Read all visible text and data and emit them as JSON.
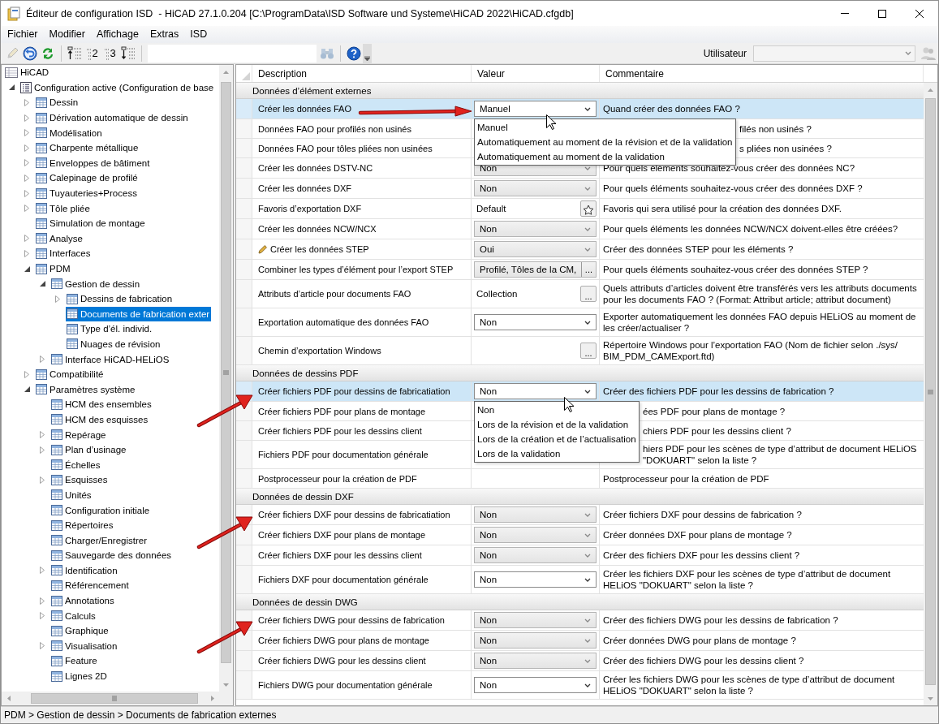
{
  "window": {
    "title": "Éditeur de configuration ISD  - HiCAD 27.1.0.204 [C:\\ProgramData\\ISD Software und Systeme\\HiCAD 2022\\HiCAD.cfgdb]"
  },
  "menu": [
    "Fichier",
    "Modifier",
    "Affichage",
    "Extras",
    "ISD"
  ],
  "toolbar": {
    "tools": [
      {
        "kind": "edit",
        "disabled": true
      },
      {
        "kind": "undo",
        "disabled": false
      },
      {
        "kind": "refresh",
        "disabled": false
      },
      {
        "kind": "separator"
      },
      {
        "kind": "collapse",
        "disabled": false
      },
      {
        "kind": "level",
        "label": "2",
        "disabled": false
      },
      {
        "kind": "level",
        "label": "3",
        "disabled": false
      },
      {
        "kind": "expand",
        "disabled": false
      },
      {
        "kind": "separator"
      },
      {
        "kind": "field"
      },
      {
        "kind": "find",
        "disabled": true
      },
      {
        "kind": "separator"
      },
      {
        "kind": "help",
        "disabled": false
      },
      {
        "kind": "overflow",
        "disabled": false
      }
    ],
    "user_label": "Utilisateur",
    "user_disabled": true
  },
  "tree": {
    "label": "HiCAD",
    "selected": false,
    "children": [
      {
        "label": "Configuration active (Configuration de base",
        "expanded": true,
        "selected": false,
        "children": [
          {
            "label": "Dessin",
            "expanded": false,
            "selected": false
          },
          {
            "label": "Dérivation automatique de dessin",
            "expanded": false,
            "selected": false
          },
          {
            "label": "Modélisation",
            "expanded": false,
            "selected": false
          },
          {
            "label": "Charpente métallique",
            "expanded": false,
            "selected": false
          },
          {
            "label": "Enveloppes de bâtiment",
            "expanded": false,
            "selected": false
          },
          {
            "label": "Calepinage de profilé",
            "expanded": false,
            "selected": false
          },
          {
            "label": "Tuyauteries+Process",
            "expanded": false,
            "selected": false
          },
          {
            "label": "Tôle pliée",
            "expanded": false,
            "selected": false
          },
          {
            "label": "Simulation de montage",
            "selected": false
          },
          {
            "label": "Analyse",
            "expanded": false,
            "selected": false
          },
          {
            "label": "Interfaces",
            "expanded": false,
            "selected": false
          },
          {
            "label": "PDM",
            "expanded": true,
            "selected": false,
            "children": [
              {
                "label": "Gestion de dessin",
                "expanded": true,
                "selected": false,
                "children": [
                  {
                    "label": "Dessins de fabrication",
                    "expanded": false,
                    "selected": false
                  },
                  {
                    "label": "Documents de fabrication exter",
                    "selected": true
                  },
                  {
                    "label": "Type d’él. individ.",
                    "selected": false
                  },
                  {
                    "label": "Nuages de révision",
                    "selected": false
                  }
                ]
              },
              {
                "label": "Interface HiCAD-HELiOS",
                "expanded": false,
                "selected": false
              }
            ]
          },
          {
            "label": "Compatibilité",
            "expanded": false,
            "selected": false
          },
          {
            "label": "Paramètres système",
            "expanded": true,
            "selected": false,
            "children": [
              {
                "label": "HCM des ensembles",
                "selected": false
              },
              {
                "label": "HCM des esquisses",
                "selected": false
              },
              {
                "label": "Repérage",
                "expanded": false,
                "selected": false
              },
              {
                "label": "Plan d’usinage",
                "expanded": false,
                "selected": false
              },
              {
                "label": "Échelles",
                "selected": false
              },
              {
                "label": "Esquisses",
                "expanded": false,
                "selected": false
              },
              {
                "label": "Unités",
                "selected": false
              },
              {
                "label": "Configuration initiale",
                "selected": false
              },
              {
                "label": "Répertoires",
                "selected": false
              },
              {
                "label": "Charger/Enregistrer",
                "selected": false
              },
              {
                "label": "Sauvegarde des données",
                "selected": false
              },
              {
                "label": "Identification",
                "expanded": false,
                "selected": false
              },
              {
                "label": "Référencement",
                "selected": false
              },
              {
                "label": "Annotations",
                "expanded": false,
                "selected": false
              },
              {
                "label": "Calculs",
                "expanded": false,
                "selected": false
              },
              {
                "label": "Graphique",
                "selected": false
              },
              {
                "label": "Visualisation",
                "expanded": false,
                "selected": false
              },
              {
                "label": "Feature",
                "selected": false
              },
              {
                "label": "Lignes 2D",
                "selected": false
              }
            ]
          }
        ]
      }
    ]
  },
  "grid": {
    "columns": [
      "Description",
      "Valeur",
      "Commentaire"
    ],
    "sections": [
      {
        "title": "Données d’élément externes",
        "rows": [
          {
            "description": "Créer les données FAO",
            "kind": "field",
            "value": "Manuel",
            "comment": "Quand créer des données FAO ?",
            "selected": true,
            "modified": false,
            "options": [
              "Manuel",
              "Automatiquement au moment de la révision et de la validation",
              "Automatiquement au moment de la validation"
            ]
          },
          {
            "description": "Données FAO pour profilés non usinés",
            "kind": "empty",
            "comment": "filés non usinés ?",
            "selected": false,
            "modified": false
          },
          {
            "description": "Données FAO pour tôles pliées non usinées",
            "kind": "empty",
            "comment": "s pliées non usinées ?",
            "selected": false,
            "modified": false
          },
          {
            "description": "Créer les données DSTV-NC",
            "kind": "combo",
            "value": "Non",
            "comment": "Pour quels éléments souhaitez-vous créer des données NC?",
            "selected": false,
            "modified": false
          },
          {
            "description": "Créer les données DXF",
            "kind": "combo",
            "value": "Non",
            "comment": "Pour quels éléments souhaitez-vous créer des données DXF ?",
            "selected": false,
            "modified": false
          },
          {
            "description": "Favoris d’exportation DXF",
            "kind": "star",
            "value": "Default",
            "comment": "Favoris qui sera utilisé pour la création des données DXF.",
            "selected": false,
            "modified": false
          },
          {
            "description": "Créer les données NCW/NCX",
            "kind": "combo",
            "value": "Non",
            "comment": "Pour quels éléments les données NCW/NCX doivent-elles être créées?",
            "selected": false,
            "modified": false
          },
          {
            "description": "Créer les données STEP",
            "kind": "combo",
            "value": "Oui",
            "comment": "Créer des données STEP pour les éléments ?",
            "selected": false,
            "modified": true
          },
          {
            "description": "Combiner les types d’élément pour l’export STEP",
            "kind": "box",
            "value": "Profilé, Tôles de la CM,",
            "button": "...",
            "comment": "Pour quels éléments souhaitez-vous créer des données STEP ?",
            "selected": false,
            "modified": false
          },
          {
            "description": "Attributs d’article pour documents FAO",
            "kind": "ellipsis",
            "value": "Collection",
            "button": "...",
            "comment": "Quels attributs d’articles doivent être transférés vers les attributs documents pour les documents FAO ?  (Format: Attribut article; attribut document)",
            "selected": false,
            "modified": false
          },
          {
            "description": "Exportation automatique des données FAO",
            "kind": "field",
            "value": "Non",
            "comment": "Exporter automatiquement les données FAO depuis HELiOS au moment de les créer/actualiser ?",
            "selected": false,
            "modified": false
          },
          {
            "description": "Chemin d’exportation Windows",
            "kind": "ellipsis",
            "button": "...",
            "comment": "Répertoire Windows pour l’exportation FAO (Nom de fichier selon ./sys/ BIM_PDM_CAMExport.ftd)",
            "selected": false,
            "modified": false
          }
        ]
      },
      {
        "title": "Données de dessins PDF",
        "rows": [
          {
            "description": "Créer fichiers PDF pour dessins de fabricatiation",
            "kind": "field",
            "value": "Non",
            "comment": "Créer des fichiers PDF pour les dessins de fabrication ?",
            "selected": true,
            "modified": false,
            "options": [
              "Non",
              "Lors de la révision et de la validation",
              "Lors de la création et de l’actualisation",
              "Lors de la validation"
            ]
          },
          {
            "description": "Créer fichiers PDF pour plans de montage",
            "kind": "empty",
            "comment": "ées PDF pour plans de montage ?",
            "selected": false,
            "modified": false
          },
          {
            "description": "Créer fichiers PDF pour les dessins client",
            "kind": "empty",
            "comment": "chiers PDF pour les dessins client ?",
            "selected": false,
            "modified": false
          },
          {
            "description": "Fichiers PDF pour documentation générale",
            "kind": "empty",
            "comment": "hiers PDF pour les scènes de type d’attribut de document HELiOS \"DOKUART\" selon la liste ?",
            "selected": false,
            "modified": false
          },
          {
            "description": "Postprocesseur pour la création de PDF",
            "kind": "empty",
            "comment": "Postprocesseur pour la création de PDF",
            "selected": false,
            "modified": false
          }
        ]
      },
      {
        "title": "Données de dessin DXF",
        "rows": [
          {
            "description": "Créer fichiers DXF pour dessins de fabricatiation",
            "kind": "combo",
            "value": "Non",
            "comment": "Créer fichiers DXF pour dessins de fabrication ?",
            "selected": false,
            "modified": false
          },
          {
            "description": "Créer fichiers DXF pour plans de montage",
            "kind": "combo",
            "value": "Non",
            "comment": "Créer données DXF pour plans de montage ?",
            "selected": false,
            "modified": false
          },
          {
            "description": "Créer fichiers DXF pour les dessins client",
            "kind": "combo",
            "value": "Non",
            "comment": "Créer des fichiers DXF pour les dessins client ?",
            "selected": false,
            "modified": false
          },
          {
            "description": "Fichiers DXF pour documentation générale",
            "kind": "field",
            "value": "Non",
            "comment": "Créer les fichiers DXF pour les scènes de type d’attribut de document HELiOS \"DOKUART\" selon la liste ?",
            "selected": false,
            "modified": false
          }
        ]
      },
      {
        "title": "Données de dessin DWG",
        "rows": [
          {
            "description": "Créer fichiers DWG pour dessins de fabrication",
            "kind": "combo",
            "value": "Non",
            "comment": "Créer des fichiers DWG pour les dessins de fabrication ?",
            "selected": false,
            "modified": false
          },
          {
            "description": "Créer fichiers DWG pour plans de montage",
            "kind": "combo",
            "value": "Non",
            "comment": "Créer données DWG pour plans de montage ?",
            "selected": false,
            "modified": false
          },
          {
            "description": "Créer fichiers DWG pour les dessins client",
            "kind": "combo",
            "value": "Non",
            "comment": "Créer des fichiers DWG pour les dessins client ?",
            "selected": false,
            "modified": false
          },
          {
            "description": "Fichiers DWG pour documentation générale",
            "kind": "field",
            "value": "Non",
            "comment": "Créer les fichiers DWG pour les scènes de type d’attribut de document HELiOS \"DOKUART\" selon la liste ?",
            "selected": false,
            "modified": false
          }
        ]
      }
    ]
  },
  "status_bar": "PDM > Gestion de dessin > Documents de fabrication externes"
}
